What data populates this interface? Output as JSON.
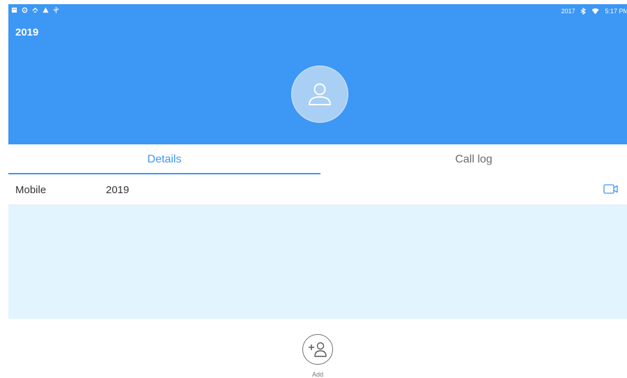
{
  "status_bar": {
    "left_icons": [
      "notification-icon",
      "settings-notification-icon",
      "sync-icon",
      "warning-icon",
      "usb-icon"
    ],
    "right_text": "2017",
    "bluetooth_icon": "bluetooth-icon",
    "wifi_icon": "wifi-icon",
    "time": "5:17 PM"
  },
  "header": {
    "title": "2019",
    "avatar_icon": "person-icon",
    "color": "#3d97f4"
  },
  "tabs": [
    {
      "label": "Details",
      "active": true
    },
    {
      "label": "Call log",
      "active": false
    }
  ],
  "details": {
    "rows": [
      {
        "label": "Mobile",
        "value": "2019",
        "action_icon": "video-call-icon"
      }
    ]
  },
  "bottom_bar": {
    "add_icon": "add-contact-icon",
    "add_label": "Add"
  },
  "colors": {
    "accent": "#3d97f4",
    "empty_area": "#e2f4fd"
  }
}
